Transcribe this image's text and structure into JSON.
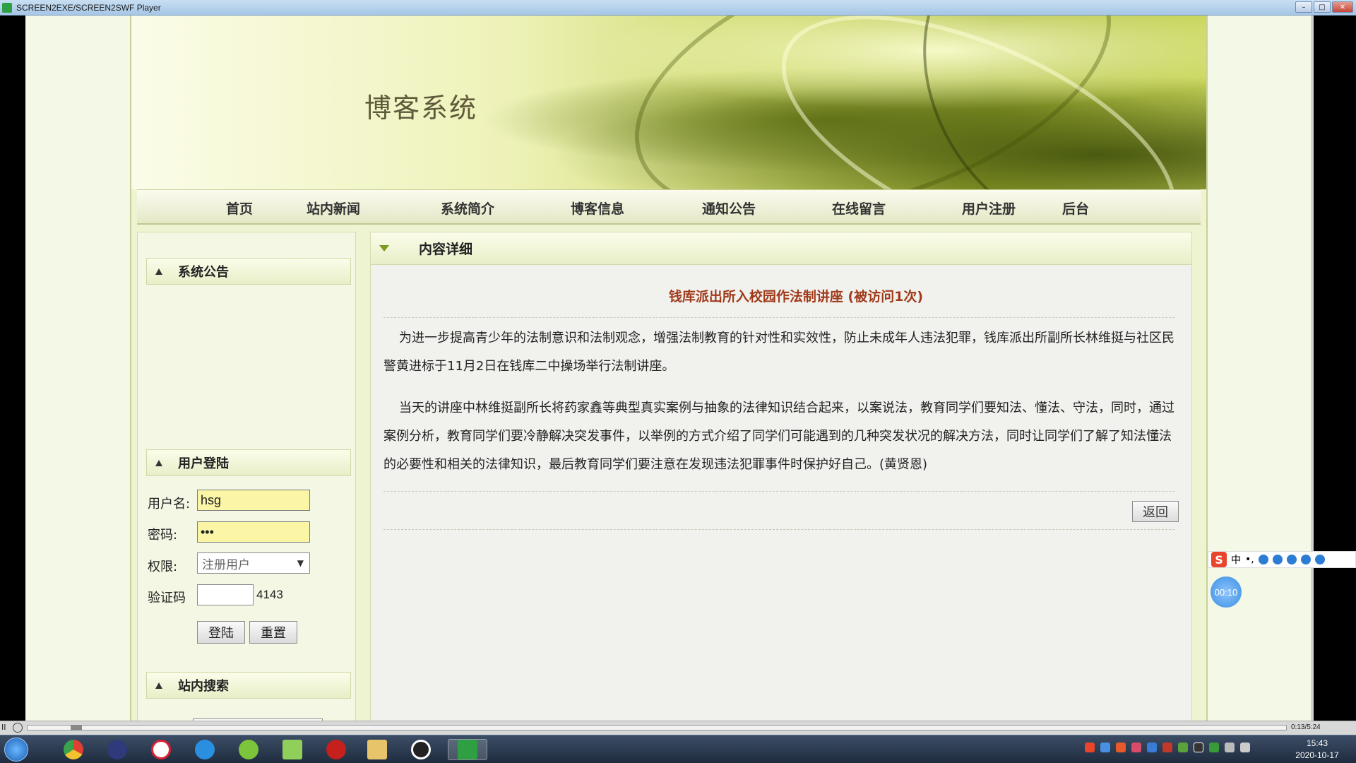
{
  "window": {
    "title": "SCREEN2EXE/SCREEN2SWF Player",
    "minimize_label": "–",
    "maximize_label": "□",
    "close_label": "✕"
  },
  "site": {
    "title": "博客系统"
  },
  "nav": {
    "items": [
      "首页",
      "站内新闻",
      "系统简介",
      "博客信息",
      "通知公告",
      "在线留言",
      "用户注册",
      "后台"
    ]
  },
  "sidebar": {
    "announcement_header": "系统公告",
    "login_header": "用户登陆",
    "search_header": "站内搜索",
    "login": {
      "username_label": "用户名:",
      "username_value": "hsg",
      "password_label": "密码:",
      "password_value": "•••",
      "role_label": "权限:",
      "role_selected": "注册用户",
      "captcha_label": "验证码",
      "captcha_code": "4143",
      "login_button": "登陆",
      "reset_button": "重置"
    }
  },
  "content": {
    "header": "内容详细",
    "article_title": "钱库派出所入校园作法制讲座 (被访问1次)",
    "paragraphs": [
      "为进一步提高青少年的法制意识和法制观念，增强法制教育的针对性和实效性，防止未成年人违法犯罪，钱库派出所副所长林维挺与社区民警黄进标于11月2日在钱库二中操场举行法制讲座。",
      "当天的讲座中林维挺副所长将药家鑫等典型真实案例与抽象的法律知识结合起来，以案说法，教育同学们要知法、懂法、守法，同时，通过案例分析，教育同学们要冷静解决突发事件，以举例的方式介绍了同学们可能遇到的几种突发状况的解决方法，同时让同学们了解了知法懂法的必要性和相关的法律知识，最后教育同学们要注意在发现违法犯罪事件时保护好自己。(黄贤恩)"
    ],
    "back_button": "返回"
  },
  "ime": {
    "logo": "S",
    "mode": "中",
    "punct": "•,",
    "timer": "00:10"
  },
  "player": {
    "pause_label": "II",
    "time": "0:13/5:24",
    "progress": 0.035
  },
  "taskbar": {
    "time": "15:43",
    "date": "2020-10-17"
  }
}
